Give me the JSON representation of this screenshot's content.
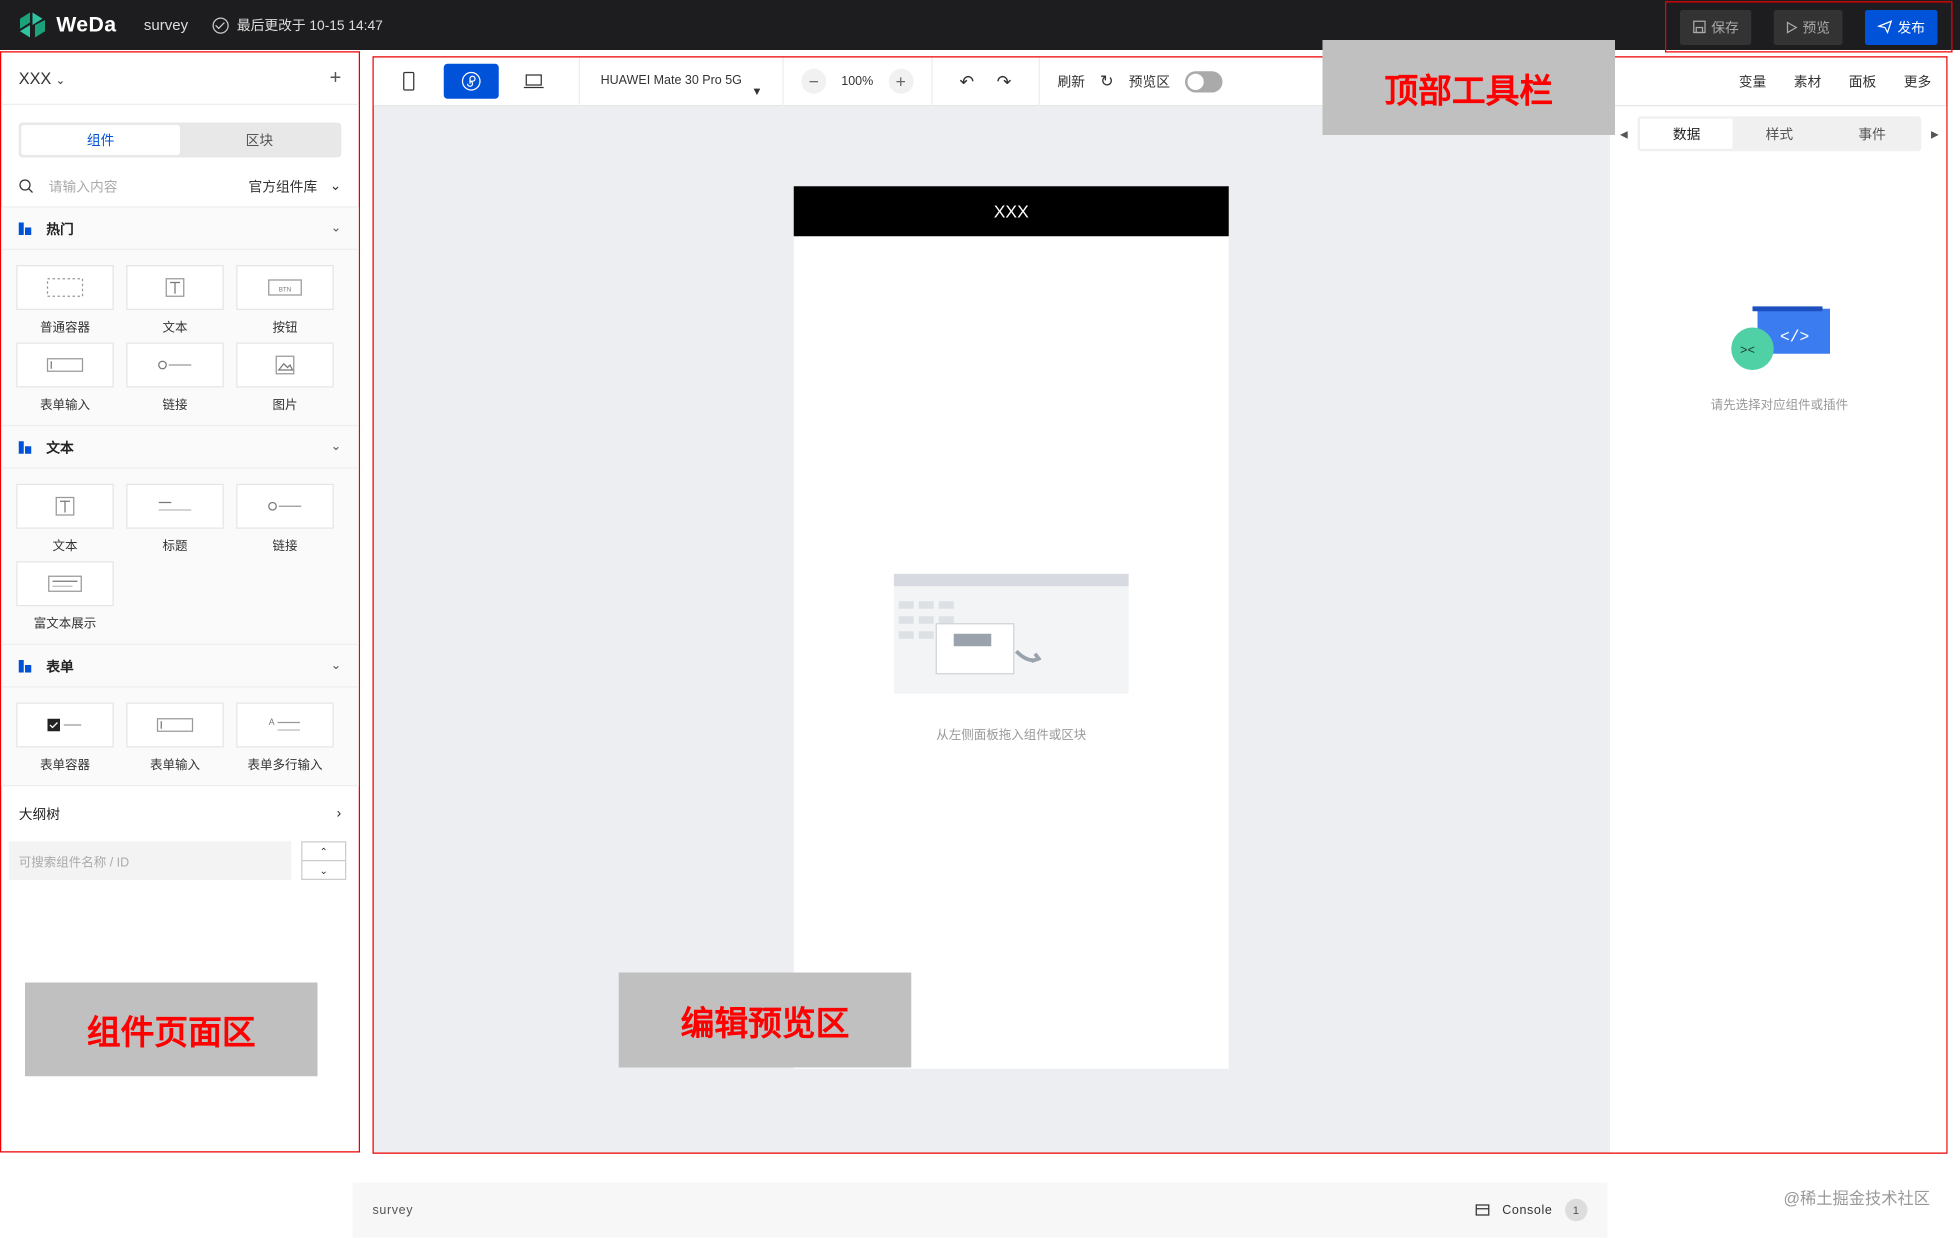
{
  "header": {
    "app_name": "WeDa",
    "project": "survey",
    "saved_text": "最后更改于 10-15 14:47",
    "save_label": "保存",
    "preview_label": "预览",
    "publish_label": "发布"
  },
  "left": {
    "app_selector": "XXX",
    "tabs": [
      "组件",
      "区块"
    ],
    "search_placeholder": "请输入内容",
    "library": "官方组件库",
    "categories": [
      {
        "title": "热门",
        "items": [
          "普通容器",
          "文本",
          "按钮",
          "表单输入",
          "链接",
          "图片"
        ]
      },
      {
        "title": "文本",
        "items": [
          "文本",
          "标题",
          "链接",
          "富文本展示"
        ]
      },
      {
        "title": "表单",
        "items": [
          "表单容器",
          "表单输入",
          "表单多行输入"
        ]
      }
    ],
    "outline_label": "大纲树",
    "tree_search_placeholder": "可搜索组件名称 / ID"
  },
  "toolbar": {
    "device": "HUAWEI Mate 30 Pro 5G",
    "zoom": "100%",
    "refresh": "刷新",
    "preview_zone": "预览区",
    "right_items": [
      "变量",
      "素材",
      "面板",
      "更多"
    ]
  },
  "canvas": {
    "page_title": "XXX",
    "empty_hint": "从左侧面板拖入组件或区块"
  },
  "right": {
    "tabs": [
      "数据",
      "样式",
      "事件"
    ],
    "empty_hint": "请先选择对应组件或插件"
  },
  "status": {
    "project": "survey",
    "console_label": "Console",
    "console_count": "1"
  },
  "overlays": {
    "toolbar_label": "顶部工具栏",
    "left_label": "组件页面区",
    "canvas_label": "编辑预览区"
  },
  "watermark": "@稀土掘金技术社区",
  "colors": {
    "accent": "#0052d9",
    "topbar": "#1d1d1f",
    "annotation": "#ff0000"
  }
}
